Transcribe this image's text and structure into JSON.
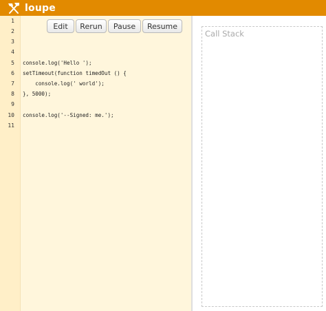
{
  "app": {
    "name": "loupe",
    "logo_icon": "crossed-tools-icon",
    "accent": "#e28a00"
  },
  "toolbar": {
    "edit_label": "Edit",
    "rerun_label": "Rerun",
    "pause_label": "Pause",
    "resume_label": "Resume"
  },
  "editor": {
    "line_numbers": [
      "1",
      "2",
      "3",
      "4",
      "5",
      "6",
      "7",
      "8",
      "9",
      "10",
      "11"
    ],
    "lines": [
      "",
      "",
      "",
      "",
      "console.log('Hello ');",
      "setTimeout(function timedOut () {",
      "    console.log(' world');",
      "}, 5000);",
      "",
      "console.log('--Signed: me.');",
      ""
    ]
  },
  "call_stack": {
    "title": "Call Stack"
  }
}
